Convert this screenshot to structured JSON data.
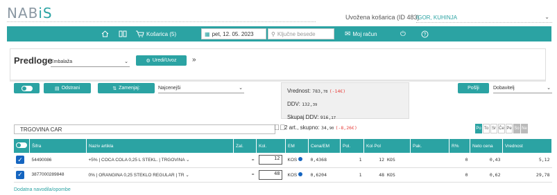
{
  "logo": {
    "text_a": "NAB",
    "text_b": "iS"
  },
  "header": {
    "cart_info": "Uvožena košarica (ID 483)",
    "cart_user": "IGOR, KUHINJA"
  },
  "nav": {
    "cart_label": "Košarica (5)",
    "date": "pet, 12. 05. 2023",
    "search_placeholder": "Ključne besede",
    "account": "Moj račun"
  },
  "templates": {
    "title": "Predloge",
    "selected": "Embalaža",
    "edit_button": "Uredi/Uvoz",
    "more": "»"
  },
  "toolbar": {
    "remove": "Odstrani",
    "replace": "Zamenjaj:",
    "replace_option": "Najcenejši",
    "send": "Pošlji",
    "supplier_option": "Dobavitelj"
  },
  "totals": {
    "value_label": "Vrednost:",
    "value": "783,",
    "value_dec": "78",
    "value_diff": "(-14€)",
    "vat_label": "DDV:",
    "vat": "132,",
    "vat_dec": "39",
    "total_label": "Skupaj DDV:",
    "total": "916,",
    "total_dec": "17"
  },
  "store": {
    "name": "TRGOVINA CAR",
    "summary": "2 art., skupno:",
    "sum_value": "34,",
    "sum_dec": "90",
    "sum_diff": "(-8,26€)",
    "days": [
      "Po",
      "To",
      "Sr",
      "Če",
      "Pe",
      "So",
      "Ne"
    ]
  },
  "table": {
    "headers": [
      "Šifra",
      "Naziv artikla",
      "Zal.",
      "Kol.",
      "EM",
      "Cena/EM",
      "Pol.",
      "Kol·Pol",
      "Pak.",
      "R%",
      "Neto cena",
      "Vrednost"
    ],
    "rows": [
      {
        "code": "54490086",
        "discount": "+5%",
        "name": "| COCA COLA 0,25 L STEKL. | TRGOVINA",
        "stock": "=",
        "qty": "12",
        "unit": "KOS",
        "price": "0,4368",
        "pol": "1",
        "kolpol": "12 KOS",
        "pak": "",
        "r": "0",
        "net": "0,43",
        "value": "5,12"
      },
      {
        "code": "3877000289848",
        "discount": "0%",
        "name": "| ORANGINA 0,25 STEKLO REGULAR | TR",
        "stock": "=",
        "qty": "48",
        "unit": "KOS",
        "price": "0,6204",
        "pol": "1",
        "kolpol": "48 KOS",
        "pak": "",
        "r": "0",
        "net": "0,62",
        "value": "29,78"
      }
    ]
  },
  "footer": {
    "link": "Dodatna navodila/opombe"
  },
  "colors": {
    "accent": "#2ba3a3",
    "checkbox": "#1565c0",
    "diff": "#e53935"
  }
}
